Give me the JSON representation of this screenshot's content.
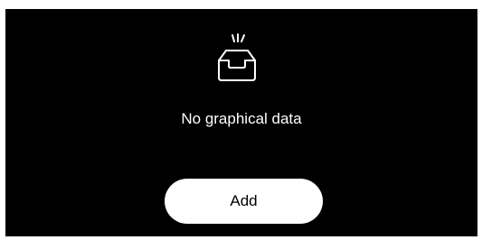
{
  "empty_state": {
    "icon": "empty-inbox-icon",
    "message": "No graphical data",
    "add_label": "Add"
  },
  "colors": {
    "panel_background": "#000000",
    "text": "#ffffff",
    "button_background": "#ffffff",
    "button_text": "#000000"
  }
}
